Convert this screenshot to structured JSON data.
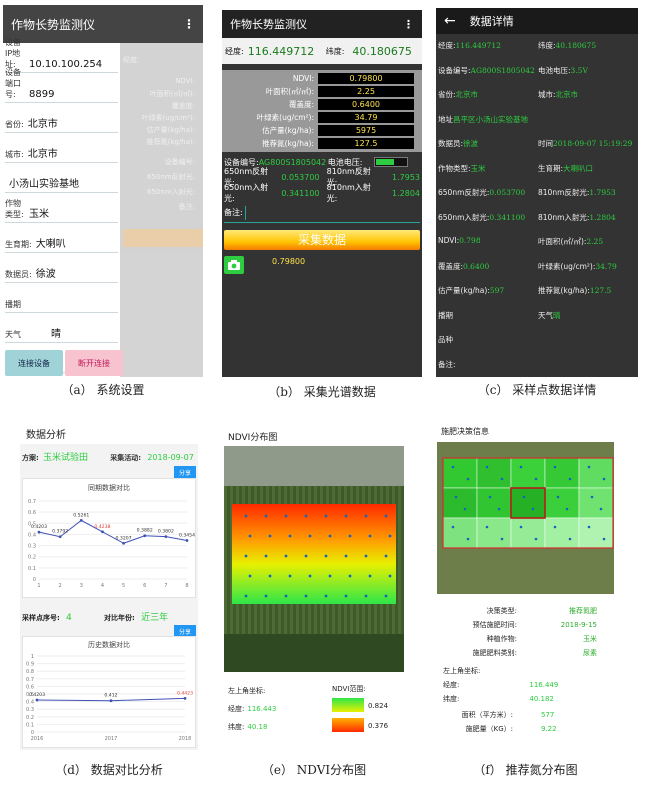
{
  "captions": {
    "a": "（a） 系统设置",
    "b": "（b） 采集光谱数据",
    "c": "（c） 采样点数据详情",
    "d": "（d） 数据对比分析",
    "e": "（e） NDVI分布图",
    "f": "（f） 推荐氮分布图"
  },
  "settings": {
    "title": "作物长势监测仪",
    "menu_icon": "⋮",
    "fields": [
      {
        "label": "设备IP地址:",
        "value": "10.10.100.254"
      },
      {
        "label": "设备端口号:",
        "value": "8899"
      },
      {
        "label": "省份:",
        "value": "北京市"
      },
      {
        "label": "城市:",
        "value": "北京市"
      },
      {
        "label": "",
        "value": "小汤山实验基地"
      },
      {
        "label": "作物类型:",
        "value": "玉米"
      },
      {
        "label": "生育期:",
        "value": "大喇叭"
      },
      {
        "label": "数据员:",
        "value": "徐波"
      },
      {
        "label": "播期",
        "value": ""
      },
      {
        "label": "天气",
        "value": "晴"
      },
      {
        "label": "品种",
        "value": ""
      }
    ],
    "connect_label": "连接设备",
    "disconnect_label": "断开连接",
    "overlay": [
      "NDVI:",
      "叶面积(㎡/㎡):",
      "覆盖度:",
      "叶绿素(ug/cm²):",
      "估产量(kg/ha):",
      "推荐氮(kg/ha):"
    ],
    "overlay_left": [
      "设备编号:",
      "650nm反射光:",
      "650nm入射光:",
      "备注:"
    ],
    "overlay_left_top": "经度:"
  },
  "collect": {
    "title": "作物长势监测仪",
    "menu_icon": "⋮",
    "lon_label": "经度:",
    "lon": "116.449712",
    "lat_label": "纬度:",
    "lat": "40.180675",
    "metrics": [
      {
        "label": "NDVI:",
        "value": "0.79800"
      },
      {
        "label": "叶面积(㎡/㎡):",
        "value": "2.25"
      },
      {
        "label": "覆盖度:",
        "value": "0.6400"
      },
      {
        "label": "叶绿素(ug/cm²):",
        "value": "34.79"
      },
      {
        "label": "估产量(kg/ha):",
        "value": "5975"
      },
      {
        "label": "推荐氮(kg/ha):",
        "value": "127.5"
      }
    ],
    "device_label": "设备编号:",
    "device": "AG800S1805042",
    "battery_label": "电池电压:",
    "r650_label": "650nm反射光:",
    "r650": "0.053700",
    "r810_label": "810nm反射光:",
    "r810": "1.7953",
    "i650_label": "650nm入射光:",
    "i650": "0.341100",
    "i810_label": "810nm入射光:",
    "i810": "1.2804",
    "note_label": "备注:",
    "collect_button": "采集数据",
    "camera_value": "0.79800"
  },
  "detail": {
    "back_icon": "←",
    "title": "数据详情",
    "rows": [
      [
        {
          "label": "经度:",
          "value": "116.449712"
        },
        {
          "label": "纬度:",
          "value": "40.180675"
        }
      ],
      [
        {
          "label": "设备编号:",
          "value": "AG800S1805042"
        },
        {
          "label": "电池电压:",
          "value": "3.5V"
        }
      ],
      [
        {
          "label": "省份:",
          "value": "北京市"
        },
        {
          "label": "城市:",
          "value": "北京市"
        }
      ],
      [
        {
          "label": "地址",
          "value": "昌平区小汤山实验基地"
        }
      ],
      [
        {
          "label": "数据员:",
          "value": "徐波"
        },
        {
          "label": "时间",
          "value": "2018-09-07 15:19:29"
        }
      ],
      [
        {
          "label": "作物类型:",
          "value": "玉米"
        },
        {
          "label": "生育期:",
          "value": "大喇叭口"
        }
      ],
      [
        {
          "label": "650nm反射光:",
          "value": "0.053700"
        },
        {
          "label": "810nm反射光:",
          "value": "1.7953"
        }
      ],
      [
        {
          "label": "650nm入射光:",
          "value": "0.341100"
        },
        {
          "label": "810nm入射光:",
          "value": "1.2804"
        }
      ],
      [
        {
          "label": "NDVI:",
          "value": "0.798"
        },
        {
          "label": "叶面积(㎡/㎡):",
          "value": "2.25"
        }
      ],
      [
        {
          "label": "覆盖度:",
          "value": "0.6400"
        },
        {
          "label": "叶绿素(ug/cm²):",
          "value": "34.79"
        }
      ],
      [
        {
          "label": "估产量(kg/ha):",
          "value": "597"
        },
        {
          "label": "推荐氮(kg/ha):",
          "value": "127.5"
        }
      ],
      [
        {
          "label": "播期",
          "value": ""
        },
        {
          "label": "天气",
          "value": "晴"
        }
      ],
      [
        {
          "label": "品种",
          "value": ""
        }
      ],
      [
        {
          "label": "备注:",
          "value": ""
        }
      ]
    ]
  },
  "analysis": {
    "title": "数据分析",
    "plan_label": "方案:",
    "plan": "玉米试验田",
    "activity_label": "采集活动:",
    "activity": "2018-09-07",
    "share1": "分享",
    "chart1_title": "同期数据对比",
    "point_label": "采样点序号:",
    "point": "4",
    "year_label": "对比年份:",
    "year": "近三年",
    "share2": "分享",
    "chart2_title": "历史数据对比"
  },
  "chart_data": [
    {
      "type": "line",
      "title": "同期数据对比",
      "x": [
        "1",
        "2",
        "3",
        "4",
        "5",
        "6",
        "7",
        "8"
      ],
      "series": [
        {
          "values": [
            0.4203,
            0.3792,
            0.5261,
            0.4238,
            0.3207,
            0.3882,
            0.3802,
            0.3454
          ]
        }
      ],
      "highlight_index": 3,
      "ylim": [
        0,
        0.7
      ],
      "yticks": [
        "0.7",
        "0.6",
        "0.5",
        "0.4",
        "0.3",
        "0.2",
        "0.1",
        "0"
      ]
    },
    {
      "type": "line",
      "title": "历史数据对比",
      "x": [
        "2016",
        "2017",
        "2018"
      ],
      "series": [
        {
          "values": [
            0.4203,
            0.412,
            0.4423
          ]
        }
      ],
      "highlight_index": 2,
      "ylim": [
        0,
        1
      ],
      "yticks": [
        "1",
        "0.9",
        "0.8",
        "0.7",
        "0.6",
        "0.5",
        "0.4",
        "0.3",
        "0.2",
        "0.1",
        "0"
      ]
    }
  ],
  "ndvi": {
    "title": "NDVI分布图",
    "corner_label": "左上角坐标:",
    "lon_label": "经度:",
    "lon": "116.443",
    "lat_label": "纬度:",
    "lat": "40.18",
    "range_label": "NDVI范围:",
    "range_max": "0.824",
    "range_min": "0.376"
  },
  "nitrogen": {
    "title": "施肥决策信息",
    "info": [
      {
        "label": "决策类型:",
        "value": "推荐氮肥"
      },
      {
        "label": "预估施肥时间:",
        "value": "2018-9-15"
      },
      {
        "label": "种植作物:",
        "value": "玉米"
      },
      {
        "label": "施肥肥料类别:",
        "value": "尿素"
      }
    ],
    "corner_label": "左上角坐标:",
    "lon_label": "经度:",
    "lon": "116.449",
    "lat_label": "纬度:",
    "lat": "40.182",
    "area_label": "面积（平方米）:",
    "area": "577",
    "amount_label": "施肥量（KG）:",
    "amount": "9.22"
  }
}
